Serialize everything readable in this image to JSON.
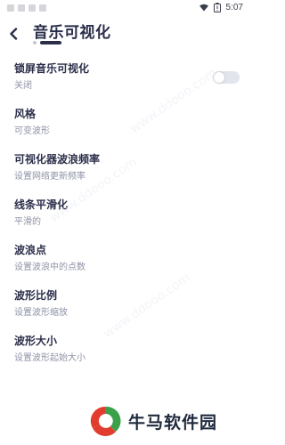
{
  "status_bar": {
    "time": "5:07"
  },
  "header": {
    "title": "音乐可视化"
  },
  "settings": [
    {
      "title": "锁屏音乐可视化",
      "subtitle": "关闭",
      "has_toggle": true,
      "toggle_on": false
    },
    {
      "title": "风格",
      "subtitle": "可变波形"
    },
    {
      "title": "可视化器波浪频率",
      "subtitle": "设置网络更新频率"
    },
    {
      "title": "线条平滑化",
      "subtitle": "平滑的"
    },
    {
      "title": "波浪点",
      "subtitle": "设置波浪中的点数"
    },
    {
      "title": "波形比例",
      "subtitle": "设置波形缩放"
    },
    {
      "title": "波形大小",
      "subtitle": "设置波形起始大小"
    }
  ],
  "footer": {
    "logo_text": "牛马软件园"
  },
  "colors": {
    "title_text": "#2b2e4a",
    "subtitle_text": "#8f93a6",
    "toggle_off": "#e3e5ec",
    "logo_red": "#e23c2f",
    "logo_green": "#3aa14a"
  },
  "icons": {
    "back": "back-arrow-icon",
    "wifi": "wifi-icon",
    "battery": "battery-icon",
    "notification": "notification-icon"
  }
}
